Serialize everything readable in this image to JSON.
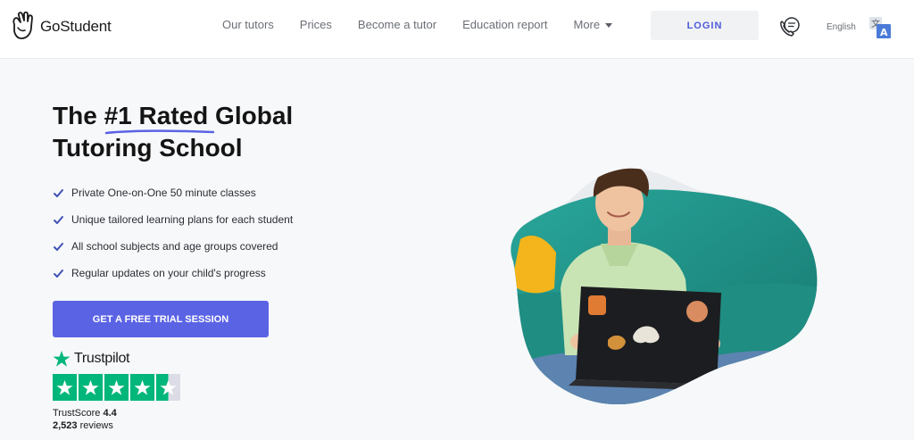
{
  "brand": {
    "name": "GoStudent"
  },
  "nav": {
    "items": [
      "Our tutors",
      "Prices",
      "Become a tutor",
      "Education report"
    ],
    "more_label": "More"
  },
  "header": {
    "login_label": "LOGIN",
    "language_label": "English"
  },
  "hero": {
    "title_prefix": "The ",
    "title_highlight": "#1 Rated",
    "title_suffix": " Global",
    "title_line2": "Tutoring School",
    "features": [
      "Private One-on-One 50 minute classes",
      "Unique tailored learning plans for each student",
      "All school subjects and age groups covered",
      "Regular updates on your child's progress"
    ],
    "cta_label": "GET A FREE TRIAL SESSION"
  },
  "trustpilot": {
    "brand": "Trustpilot",
    "score_label": "TrustScore",
    "score_value": "4.4",
    "reviews_count": "2,523",
    "reviews_label": "reviews",
    "rating": 4.5,
    "max_rating": 5
  },
  "colors": {
    "accent": "#5b63e5",
    "login_text": "#4c5bd8",
    "trustpilot_green": "#00b67a",
    "check": "#3f51b5",
    "page_bg": "#f7f8fa"
  },
  "icons": {
    "logo": "hand-wave-icon",
    "phone": "phone-chat-icon",
    "translate": "translate-icon",
    "check": "check-icon",
    "caret": "caret-down-icon"
  }
}
